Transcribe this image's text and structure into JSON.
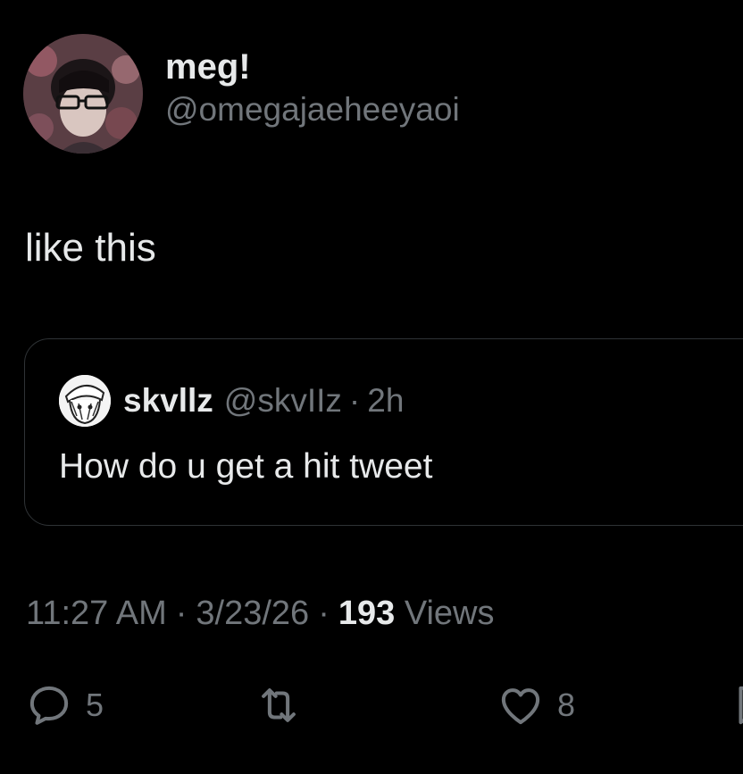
{
  "author": {
    "display_name": "meg!",
    "handle": "@omegajaeheeyaoi",
    "avatar_icon": "profile-photo"
  },
  "tweet": {
    "text": "like this"
  },
  "quote": {
    "display_name": "skvllz",
    "handle": "@skvIIz",
    "separator": "·",
    "time": "2h",
    "text": "How do u get a hit tweet",
    "avatar_icon": "anime-avatar"
  },
  "meta": {
    "time": "11:27 AM",
    "separator": "·",
    "date": "3/23/26",
    "views_count": "193",
    "views_label": "Views"
  },
  "actions": {
    "reply_icon": "reply-icon",
    "reply_count": "5",
    "repost_icon": "repost-icon",
    "like_icon": "heart-icon",
    "like_count": "8",
    "bookmark_icon": "bookmark-icon"
  },
  "colors": {
    "background": "#000000",
    "text_primary": "#e7e9ea",
    "text_secondary": "#71767b",
    "border": "#2f3336"
  }
}
